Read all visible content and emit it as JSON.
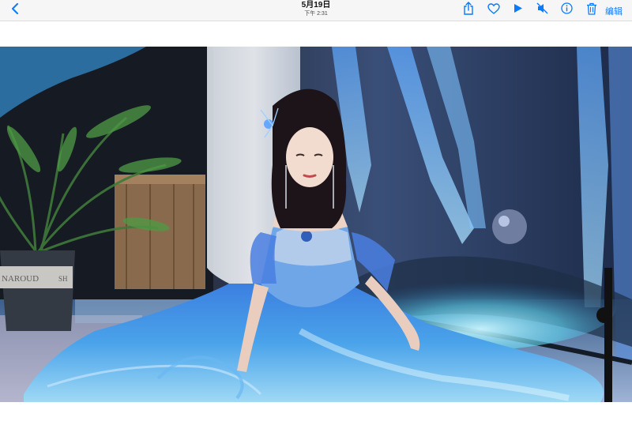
{
  "header": {
    "date": "5月19日",
    "time": "下午 2:31",
    "edit_label": "编辑"
  },
  "icons": {
    "back": "chevron-left-icon",
    "share": "share-icon",
    "favorite": "heart-icon",
    "play": "play-icon",
    "mute": "speaker-muted-icon",
    "info": "info-icon",
    "delete": "trash-icon"
  },
  "photo": {
    "sign_text": "NAROUD",
    "sign_text_right": "SH"
  },
  "colors": {
    "accent": "#0a7aff",
    "toolbar_bg": "#f6f6f7"
  }
}
